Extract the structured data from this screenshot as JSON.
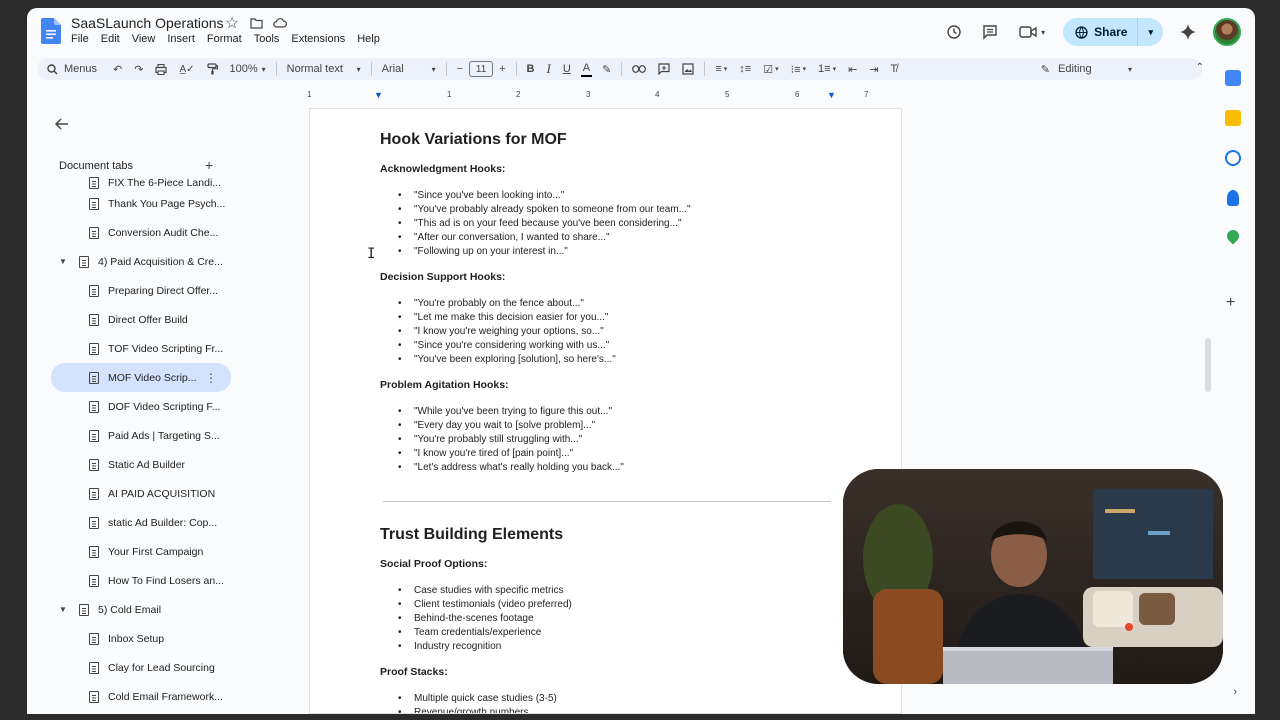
{
  "header": {
    "title": "SaaSLaunch Operations",
    "menus": [
      "File",
      "Edit",
      "View",
      "Insert",
      "Format",
      "Tools",
      "Extensions",
      "Help"
    ],
    "share_label": "Share"
  },
  "toolbar": {
    "menus_label": "Menus",
    "zoom": "100%",
    "style": "Normal text",
    "font": "Arial",
    "font_size": "11",
    "mode": "Editing"
  },
  "sidebar": {
    "title": "Document tabs",
    "tabs": [
      {
        "label": "FIX The 6-Piece Landi...",
        "level": 2,
        "clip": true
      },
      {
        "label": "Thank You Page Psych...",
        "level": 2
      },
      {
        "label": "Conversion Audit Che...",
        "level": 2
      },
      {
        "label": "4) Paid Acquisition & Cre...",
        "level": 1
      },
      {
        "label": "Preparing Direct Offer...",
        "level": 2
      },
      {
        "label": "Direct Offer Build",
        "level": 2
      },
      {
        "label": "TOF Video Scripting Fr...",
        "level": 2
      },
      {
        "label": "MOF Video Scrip...",
        "level": 2,
        "selected": true
      },
      {
        "label": "DOF Video Scripting F...",
        "level": 2
      },
      {
        "label": "Paid Ads | Targeting S...",
        "level": 2
      },
      {
        "label": "Static Ad Builder",
        "level": 2
      },
      {
        "label": "AI PAID ACQUISITION",
        "level": 2
      },
      {
        "label": "static Ad Builder: Cop...",
        "level": 2
      },
      {
        "label": "Your First Campaign",
        "level": 2
      },
      {
        "label": "How To Find Losers an...",
        "level": 2
      },
      {
        "label": "5) Cold Email",
        "level": 1
      },
      {
        "label": "Inbox Setup",
        "level": 2
      },
      {
        "label": "Clay for Lead Sourcing",
        "level": 2
      },
      {
        "label": "Cold Email Framework...",
        "level": 2
      }
    ]
  },
  "ruler": {
    "marks": [
      "1",
      "1",
      "2",
      "3",
      "4",
      "5",
      "6",
      "7"
    ]
  },
  "doc": {
    "h1a": "Hook Variations for MOF",
    "s1": "Acknowledgment Hooks:",
    "s1_items": [
      "\"Since you've been looking into...\"",
      "\"You've probably already spoken to someone from our team...\"",
      "\"This ad is on your feed because you've been considering...\"",
      "\"After our conversation, I wanted to share...\"",
      "\"Following up on your interest in...\""
    ],
    "s2": "Decision Support Hooks:",
    "s2_items": [
      "\"You're probably on the fence about...\"",
      "\"Let me make this decision easier for you...\"",
      "\"I know you're weighing your options, so...\"",
      "\"Since you're considering working with us...\"",
      "\"You've been exploring [solution], so here's...\""
    ],
    "s3": "Problem Agitation Hooks:",
    "s3_items": [
      "\"While you've been trying to figure this out...\"",
      "\"Every day you wait to [solve problem]...\"",
      "\"You're probably still struggling with...\"",
      "\"I know you're tired of [pain point]...\"",
      "\"Let's address what's really holding you back...\""
    ],
    "h1b": "Trust Building Elements",
    "s4": "Social Proof Options:",
    "s4_items": [
      "Case studies with specific metrics",
      "Client testimonials (video preferred)",
      "Behind-the-scenes footage",
      "Team credentials/experience",
      "Industry recognition"
    ],
    "s5": "Proof Stacks:",
    "s5_items": [
      "Multiple quick case studies (3-5)",
      "Revenue/growth numbers"
    ]
  },
  "colors": {
    "accent": "#0b57d0",
    "share_bg": "#c2e7ff",
    "selected_tab": "#d3e3fd"
  }
}
